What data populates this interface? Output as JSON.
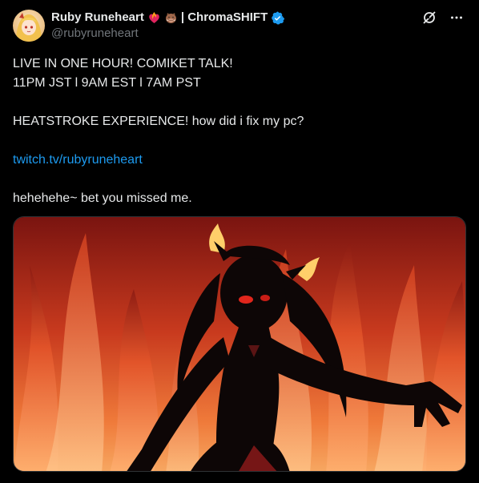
{
  "author": {
    "display_name": "Ruby Runeheart",
    "name_suffix": "| ChromaSHIFT",
    "handle": "@rubyruneheart",
    "verified": true,
    "emojis": [
      "fire-heart-emoji",
      "boar-emoji"
    ]
  },
  "header_icons": [
    "grok-icon",
    "more-icon"
  ],
  "tweet_lines": [
    "LIVE IN ONE HOUR! COMIKET TALK!",
    "11PM JST l 9AM EST l 7AM PST",
    "",
    "HEATSTROKE EXPERIENCE! how did i fix my pc?",
    "",
    "",
    "",
    "hehehehe~ bet you missed me."
  ],
  "tweet_link": "twitch.tv/rubyruneheart",
  "colors": {
    "background": "#000000",
    "text": "#e7e9ea",
    "muted": "#71767b",
    "link": "#1d9bf0",
    "verified": "#1d9bf0"
  }
}
